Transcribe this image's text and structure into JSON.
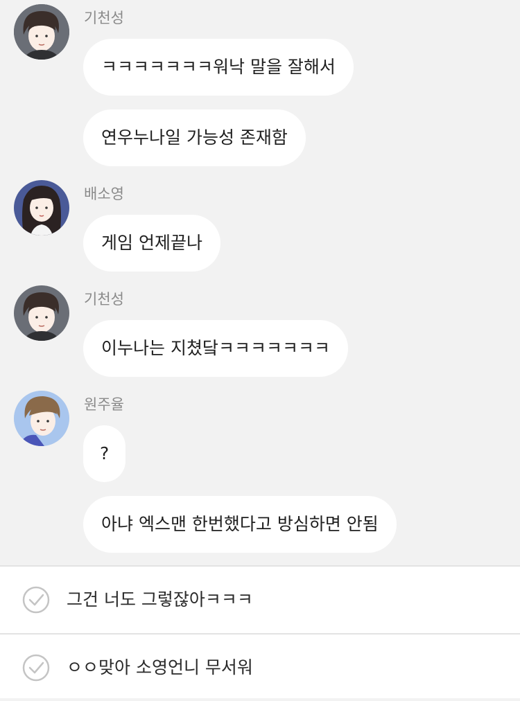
{
  "chat": {
    "groups": [
      {
        "sender": "기천성",
        "avatar": "avatar-kicheonseong",
        "messages": [
          "ㅋㅋㅋㅋㅋㅋㅋ워낙 말을 잘해서",
          "연우누나일 가능성 존재함"
        ]
      },
      {
        "sender": "배소영",
        "avatar": "avatar-baesoyoung",
        "messages": [
          "게임 언제끝나"
        ]
      },
      {
        "sender": "기천성",
        "avatar": "avatar-kicheonseong",
        "messages": [
          "이누나는 지쳤닼ㅋㅋㅋㅋㅋㅋㅋ"
        ]
      },
      {
        "sender": "원주율",
        "avatar": "avatar-wonjuyul",
        "messages": [
          "?",
          "아냐 엑스맨 한번했다고 방심하면 안됨"
        ]
      }
    ]
  },
  "replies": {
    "options": [
      {
        "label": "그건 너도 그렇잖아ㅋㅋㅋ",
        "icon": "check-circle-icon"
      },
      {
        "label": "ㅇㅇ맞아 소영언니 무서워",
        "icon": "check-circle-icon"
      }
    ]
  },
  "colors": {
    "background": "#f2f2f2",
    "bubble": "#ffffff",
    "sender_name": "#8a8a8a",
    "text": "#1f1f1f",
    "divider": "#e3e3e3",
    "check": "#c4c4c4"
  }
}
